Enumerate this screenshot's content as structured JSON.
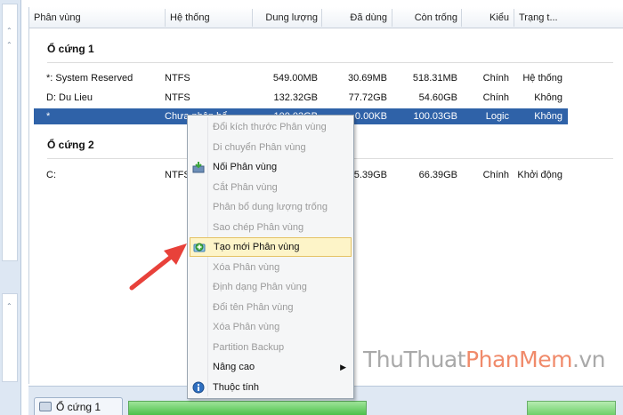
{
  "columns": {
    "partition": "Phân vùng",
    "system": "Hệ thống",
    "capacity": "Dung lượng",
    "used": "Đã dùng",
    "free": "Còn trống",
    "type": "Kiểu",
    "status": "Trạng t..."
  },
  "disk1": {
    "title": "Ổ cứng 1",
    "rows": [
      {
        "name": "*: System Reserved",
        "fs": "NTFS",
        "capacity": "549.00MB",
        "used": "30.69MB",
        "free": "518.31MB",
        "type": "Chính",
        "status": "Hệ thống"
      },
      {
        "name": "D: Du Lieu",
        "fs": "NTFS",
        "capacity": "132.32GB",
        "used": "77.72GB",
        "free": "54.60GB",
        "type": "Chính",
        "status": "Không"
      },
      {
        "name": "*",
        "fs": "Chưa phân bổ",
        "capacity": "100.03GB",
        "used": "0.00KB",
        "free": "100.03GB",
        "type": "Logic",
        "status": "Không"
      }
    ]
  },
  "disk2": {
    "title": "Ổ cứng 2",
    "rows": [
      {
        "name": "C:",
        "fs": "NTFS",
        "capacity": "",
        "used": "45.39GB",
        "free": "66.39GB",
        "type": "Chính",
        "status": "Khởi động"
      }
    ]
  },
  "context_menu": {
    "items": [
      {
        "label": "Đổi kích thước Phân vùng",
        "enabled": false
      },
      {
        "label": "Di chuyển Phân vùng",
        "enabled": false
      },
      {
        "label": "Nối Phân vùng",
        "enabled": true,
        "icon": "merge-icon"
      },
      {
        "label": "Cắt Phân vùng",
        "enabled": false
      },
      {
        "label": "Phân bổ dung lượng trống",
        "enabled": false
      },
      {
        "label": "Sao chép Phân vùng",
        "enabled": false
      },
      {
        "label": "Tạo mới Phân vùng",
        "enabled": true,
        "icon": "create-partition-icon",
        "highlighted": true
      },
      {
        "label": "Xóa Phân vùng",
        "enabled": false
      },
      {
        "label": "Định dạng Phân vùng",
        "enabled": false
      },
      {
        "label": "Đổi tên Phân vùng",
        "enabled": false
      },
      {
        "label": "Xóa Phân vùng",
        "enabled": false
      },
      {
        "label": "Partition Backup",
        "enabled": false
      },
      {
        "label": "Nâng cao",
        "enabled": true,
        "submenu": true
      },
      {
        "label": "Thuộc tính",
        "enabled": true,
        "icon": "info-icon"
      }
    ]
  },
  "bottom": {
    "disk_tab": "Ổ cứng 1"
  },
  "watermark": {
    "part1": "ThuThuat",
    "part2": "PhanMem",
    "part3": ".vn"
  },
  "colors": {
    "selection": "#2f62a8",
    "menu_highlight": "#fdf4c8",
    "arrow": "#e8413a"
  }
}
